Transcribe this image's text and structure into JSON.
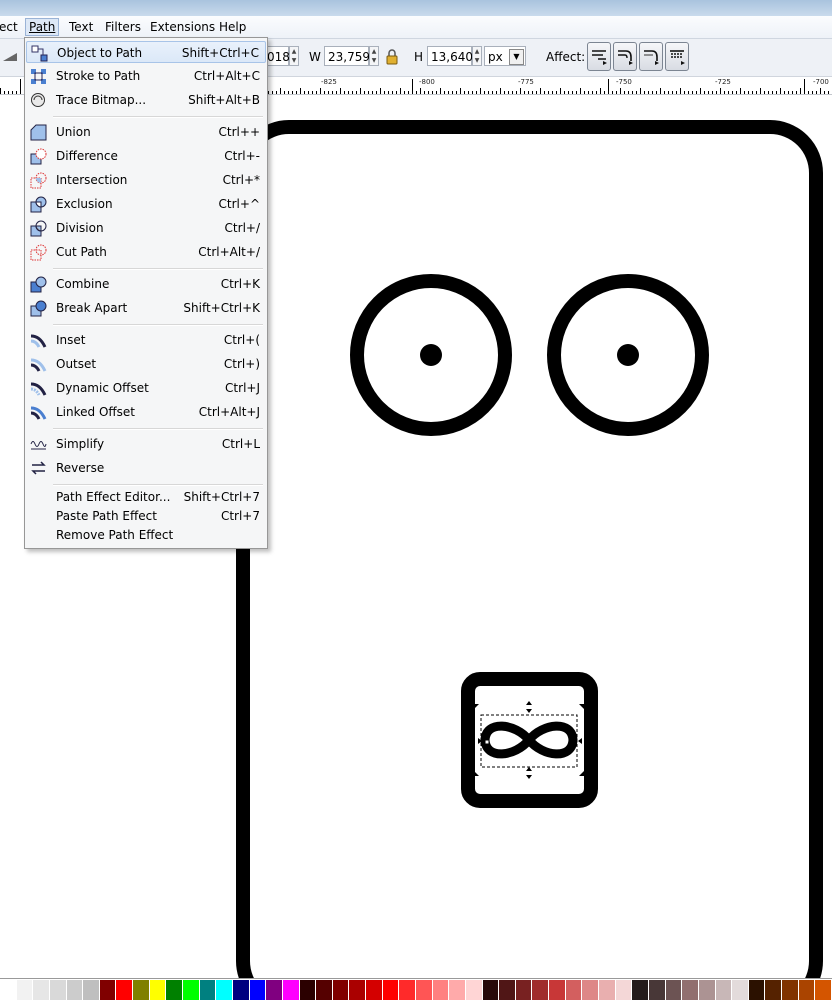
{
  "menubar": {
    "items": [
      "ect",
      "Path",
      "Text",
      "Filters",
      "Extensions",
      "Help"
    ]
  },
  "toolbar": {
    "x_partial": "018",
    "w_label": "W",
    "w_value": "23,759",
    "h_label": "H",
    "h_value": "13,640",
    "unit": "px",
    "affect_label": "Affect:"
  },
  "ruler": {
    "labels": [
      "-825",
      "-800",
      "-775",
      "-750",
      "-725",
      "-700"
    ]
  },
  "path_menu": {
    "groups": [
      [
        {
          "label": "Object to Path",
          "shortcut": "Shift+Ctrl+C",
          "icon": "object-to-path-icon",
          "highlighted": true
        },
        {
          "label": "Stroke to Path",
          "shortcut": "Ctrl+Alt+C",
          "icon": "stroke-to-path-icon"
        },
        {
          "label": "Trace Bitmap...",
          "shortcut": "Shift+Alt+B",
          "icon": "trace-bitmap-icon"
        }
      ],
      [
        {
          "label": "Union",
          "shortcut": "Ctrl++",
          "icon": "union-icon"
        },
        {
          "label": "Difference",
          "shortcut": "Ctrl+-",
          "icon": "difference-icon"
        },
        {
          "label": "Intersection",
          "shortcut": "Ctrl+*",
          "icon": "intersection-icon"
        },
        {
          "label": "Exclusion",
          "shortcut": "Ctrl+^",
          "icon": "exclusion-icon"
        },
        {
          "label": "Division",
          "shortcut": "Ctrl+/",
          "icon": "division-icon"
        },
        {
          "label": "Cut Path",
          "shortcut": "Ctrl+Alt+/",
          "icon": "cut-path-icon"
        }
      ],
      [
        {
          "label": "Combine",
          "shortcut": "Ctrl+K",
          "icon": "combine-icon"
        },
        {
          "label": "Break Apart",
          "shortcut": "Shift+Ctrl+K",
          "icon": "break-apart-icon"
        }
      ],
      [
        {
          "label": "Inset",
          "shortcut": "Ctrl+(",
          "icon": "inset-icon"
        },
        {
          "label": "Outset",
          "shortcut": "Ctrl+)",
          "icon": "outset-icon"
        },
        {
          "label": "Dynamic Offset",
          "shortcut": "Ctrl+J",
          "icon": "dynamic-offset-icon"
        },
        {
          "label": "Linked Offset",
          "shortcut": "Ctrl+Alt+J",
          "icon": "linked-offset-icon"
        }
      ],
      [
        {
          "label": "Simplify",
          "shortcut": "Ctrl+L",
          "icon": "simplify-icon"
        },
        {
          "label": "Reverse",
          "shortcut": "",
          "icon": "reverse-icon"
        }
      ],
      [
        {
          "label": "Path Effect Editor...",
          "shortcut": "Shift+Ctrl+7",
          "icon": ""
        },
        {
          "label": "Paste Path Effect",
          "shortcut": "Ctrl+7",
          "icon": ""
        },
        {
          "label": "Remove Path Effect",
          "shortcut": "",
          "icon": ""
        }
      ]
    ]
  },
  "palette": {
    "colors": [
      "#ffffff",
      "#f2f2f2",
      "#e6e6e6",
      "#d9d9d9",
      "#cccccc",
      "#bfbfbf",
      "#800000",
      "#ff0000",
      "#808000",
      "#ffff00",
      "#008000",
      "#00ff00",
      "#008080",
      "#00ffff",
      "#000080",
      "#0000ff",
      "#800080",
      "#ff00ff",
      "#2b0000",
      "#550000",
      "#800000",
      "#aa0000",
      "#d40000",
      "#ff0000",
      "#ff2a2a",
      "#ff5555",
      "#ff8080",
      "#ffaaaa",
      "#ffd5d5",
      "#280b0b",
      "#501616",
      "#782121",
      "#a02c2c",
      "#c83737",
      "#d35f5f",
      "#de8787",
      "#e9afaf",
      "#f4d7d7",
      "#241c1c",
      "#483737",
      "#6c5353",
      "#916f6f",
      "#ac9393",
      "#c8b7b7",
      "#e3dbdb",
      "#2b1100",
      "#552200",
      "#803300",
      "#aa4400",
      "#d45500"
    ]
  },
  "colors": {
    "menu_highlight": "#dbe8f8",
    "toolbar_bg": "#eef1f6"
  }
}
